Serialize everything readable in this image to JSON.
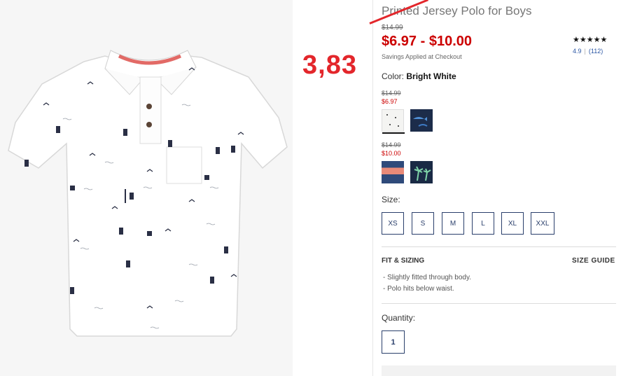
{
  "product": {
    "title": "Printed Jersey Polo for Boys",
    "original_price": "$14.99",
    "sale_price": "$6.97 - $10.00",
    "savings_note": "Savings Applied at Checkout",
    "rating_stars": "★★★★★",
    "rating_value": "4.9",
    "review_count": "(112)"
  },
  "annotation": {
    "handwritten_price": "3,83",
    "color": "#e3262b"
  },
  "color": {
    "label": "Color:",
    "selected": "Bright White",
    "groups": [
      {
        "original_price": "$14.99",
        "sale_price": "$6.97",
        "swatches": [
          "white-print",
          "navy-shark"
        ]
      },
      {
        "original_price": "$14.99",
        "sale_price": "$10.00",
        "swatches": [
          "stripe-coral-navy",
          "navy-palm"
        ]
      }
    ]
  },
  "sizes": {
    "label": "Size:",
    "options": [
      "XS",
      "S",
      "M",
      "L",
      "XL",
      "XXL"
    ]
  },
  "fit": {
    "title": "FIT & SIZING",
    "size_guide": "SIZE GUIDE",
    "items": [
      "-  Slightly fitted through body.",
      "-  Polo hits below waist."
    ]
  },
  "quantity": {
    "label": "Quantity:",
    "value": "1"
  },
  "colors": {
    "sale_red": "#cc0000",
    "button_navy": "#2a3f6b",
    "link_blue": "#2a56a4"
  }
}
